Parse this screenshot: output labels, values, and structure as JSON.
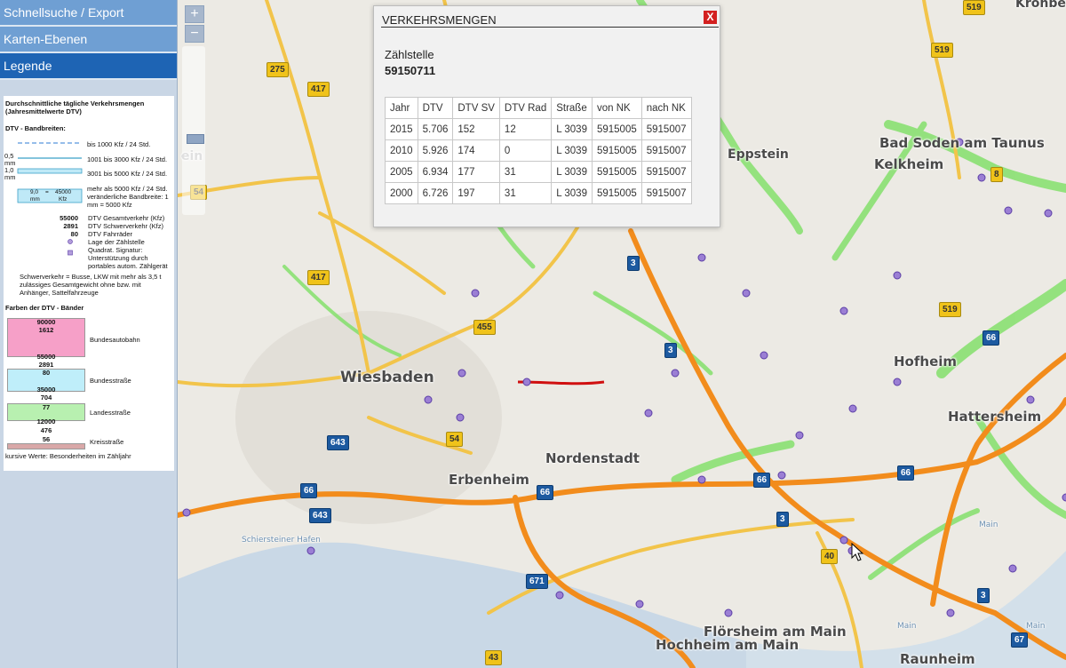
{
  "sidebar": {
    "sections": [
      {
        "label": "Schnellsuche / Export"
      },
      {
        "label": "Karten-Ebenen"
      },
      {
        "label": "Legende"
      }
    ],
    "active_section": "Legende"
  },
  "legend": {
    "title": "Durchschnittliche tägliche Verkehrsmengen (Jahresmittelwerte DTV)",
    "band_title": "DTV - Bandbreiten:",
    "band_items": [
      "bis 1000 Kfz / 24 Std.",
      "1001 bis 3000 Kfz / 24 Std.",
      "3001 bis 5000 Kfz / 24 Std.",
      "mehr als 5000 Kfz / 24 Std. veränderliche Bandbreite: 1 mm = 5000 Kfz"
    ],
    "band_scale": {
      "a": "0,5",
      "b": "1,0",
      "unit": "mm",
      "sample_left": "9,0",
      "sample_eq": "=",
      "sample_right": "45000",
      "sample_unit_left": "mm",
      "sample_unit_right": "Kfz"
    },
    "sample_values": {
      "gesamt": "55000",
      "schwer": "2891",
      "rad": "80"
    },
    "sample_labels": [
      "DTV Gesamtverkehr (Kfz)",
      "DTV Schwerverkehr (Kfz)",
      "DTV Fahrräder",
      "Lage der Zählstelle",
      "Quadrat. Signatur: Unterstützung durch portables autom. Zählgerät"
    ],
    "schwer_note": "Schwerverkehr = Busse, LKW mit mehr als 3,5 t zulässiges Gesamtgewicht ohne bzw. mit Anhänger, Sattelfahrzeuge",
    "colors_title": "Farben der DTV - Bänder",
    "classes": [
      {
        "name": "Bundesautobahn",
        "v1": "90000",
        "v2": "1612",
        "v3": "55000",
        "v4": "2891",
        "color": "#f49bc4"
      },
      {
        "name": "Bundesstraße",
        "v1": "80",
        "v2": "35000",
        "v3": "704",
        "color": "#9fe5f5"
      },
      {
        "name": "Landesstraße",
        "v1": "77",
        "v2": "12000",
        "v3": "476",
        "color": "#a7ec9f"
      },
      {
        "name": "Kreisstraße",
        "v1": "56",
        "color": "#d9a8a8"
      }
    ],
    "footer": "kursive Werte: Besonderheiten im Zähljahr"
  },
  "zoom": {
    "in": "+",
    "out": "−"
  },
  "popup": {
    "title": "VERKEHRSMENGEN",
    "close": "X",
    "label": "Zählstelle",
    "station": "59150711",
    "headers": [
      "Jahr",
      "DTV",
      "DTV SV",
      "DTV Rad",
      "Straße",
      "von NK",
      "nach NK"
    ],
    "rows": [
      [
        "2015",
        "5.706",
        "152",
        "12",
        "L 3039",
        "5915005",
        "5915007"
      ],
      [
        "2010",
        "5.926",
        "174",
        "0",
        "L 3039",
        "5915005",
        "5915007"
      ],
      [
        "2005",
        "6.934",
        "177",
        "31",
        "L 3039",
        "5915005",
        "5915007"
      ],
      [
        "2000",
        "6.726",
        "197",
        "31",
        "L 3039",
        "5915005",
        "5915007"
      ]
    ]
  },
  "map": {
    "places": [
      "Wiesbaden",
      "Erbenheim",
      "Nordenstadt",
      "Eppstein",
      "Bad Soden am Taunus",
      "Kelkheim",
      "Hofheim",
      "Hattersheim",
      "Flörsheim am Main",
      "Hochheim am Main",
      "Raunheim",
      "Kronbe",
      "Schiersteiner Hafen",
      "Main",
      "Main",
      "Main",
      "ein"
    ],
    "shields_yellow": [
      "275",
      "417",
      "417",
      "455",
      "54",
      "54",
      "40",
      "43",
      "519",
      "519",
      "519",
      "8"
    ],
    "shields_blue": [
      "3",
      "3",
      "3",
      "3",
      "66",
      "66",
      "66",
      "66",
      "643",
      "643",
      "671",
      "67"
    ],
    "colors": {
      "autobahn": "#f28c1c",
      "bundesstrasse": "#f2b736",
      "landesstrasse": "#c7e36b",
      "green_band": "#6fde55",
      "kreis": "#d01010",
      "station": "#9b7fd4"
    }
  }
}
